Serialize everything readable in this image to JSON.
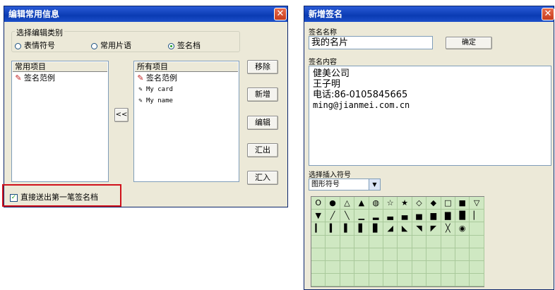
{
  "left_dialog": {
    "title": "编辑常用信息",
    "group_label": "选择编辑类别",
    "radios": [
      {
        "label": "表情符号",
        "checked": false
      },
      {
        "label": "常用片语",
        "checked": false
      },
      {
        "label": "签名档",
        "checked": true
      }
    ],
    "left_list": {
      "header": "常用项目",
      "items": [
        "签名范例"
      ]
    },
    "right_list": {
      "header": "所有项目",
      "items": [
        "签名范例",
        "My card",
        "My name"
      ]
    },
    "move_left_button": "<<",
    "buttons": [
      "移除",
      "新增",
      "编辑",
      "汇出",
      "汇入"
    ],
    "checkbox": {
      "label": "直接送出第一笔签名档",
      "checked": true
    },
    "highlight_color": "#d0111b"
  },
  "right_dialog": {
    "title": "新增签名",
    "name_label": "签名名称",
    "name_value": "我的名片",
    "confirm_button": "确定",
    "content_label": "签名内容",
    "content_lines": [
      "健美公司",
      "王子明",
      "电话:86-0105845665",
      "ming@jianmei.com.cn"
    ],
    "symbol_label": "选择插入符号",
    "symbol_select": "图形符号",
    "symbols": [
      [
        "O",
        "●",
        "△",
        "▲",
        "◍",
        "☆",
        "★",
        "◇",
        "◆",
        "□",
        "■",
        "▽"
      ],
      [
        "▼",
        "╱",
        "╲",
        "▁",
        "▂",
        "▃",
        "▄",
        "▅",
        "▆",
        "▇",
        "█",
        "▏"
      ],
      [
        "▎",
        "▍",
        "▌",
        "▋",
        "▊",
        "◢",
        "◣",
        "◥",
        "◤",
        "╳",
        "◉",
        ""
      ]
    ]
  }
}
